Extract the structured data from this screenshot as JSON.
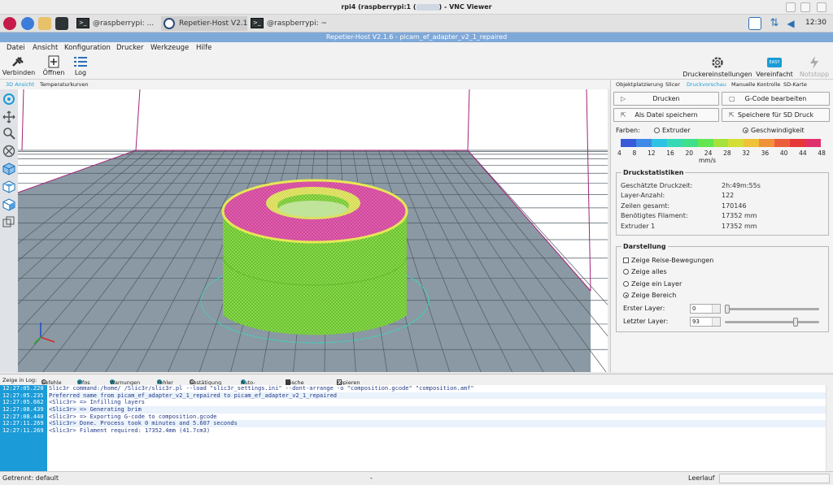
{
  "vnc": {
    "title_prefix": "rpi4 (raspberrypi:1 (",
    "title_suffix": ") - VNC Viewer"
  },
  "taskbar": {
    "tasks": [
      "@raspberrypi: ...",
      "Repetier-Host V2.1...",
      "@raspberrypi: ~"
    ],
    "time": "12:30"
  },
  "app": {
    "title": "Repetier-Host V2.1.6 - picam_ef_adapter_v2_1_repaired"
  },
  "menu": [
    "Datei",
    "Ansicht",
    "Konfiguration",
    "Drucker",
    "Werkzeuge",
    "Hilfe"
  ],
  "toolbar": {
    "connect": "Verbinden",
    "open": "Öffnen",
    "log": "Log",
    "printer_settings": "Druckereinstellungen",
    "easy_badge": "EASY",
    "simplified": "Vereinfacht",
    "emergency": "Notstopp"
  },
  "view_tabs": [
    "3D Ansicht",
    "Temperaturkurven"
  ],
  "right_tabs": [
    "Objektplatzierung",
    "Slicer",
    "Druckvorschau",
    "Manuelle Kontrolle",
    "SD-Karte"
  ],
  "preview": {
    "print": "Drucken",
    "edit_gcode": "G-Code bearbeiten",
    "save_file": "Als Datei speichern",
    "save_sd": "Speichere für SD Druck",
    "colors_label": "Farben:",
    "color_extruder": "Extruder",
    "color_speed": "Geschwindigkeit",
    "scale_colors": [
      "#3a5bd9",
      "#3f8ae6",
      "#2fc3e3",
      "#36d9b4",
      "#3fe08a",
      "#63e651",
      "#a5e23c",
      "#d4de35",
      "#efc23a",
      "#f0923a",
      "#ec5e3b",
      "#e63838",
      "#e0306a"
    ],
    "scale_ticks": [
      "4",
      "8",
      "12",
      "16",
      "20",
      "24",
      "28",
      "32",
      "36",
      "40",
      "44",
      "48"
    ],
    "scale_unit": "mm/s"
  },
  "stats": {
    "title": "Druckstatistiken",
    "rows": [
      {
        "k": "Geschätzte Druckzeit:",
        "v": "2h:49m:55s"
      },
      {
        "k": "Layer-Anzahl:",
        "v": "122"
      },
      {
        "k": "Zeilen gesamt:",
        "v": "170146"
      },
      {
        "k": "Benötigtes Filament:",
        "v": "17352 mm"
      },
      {
        "k": "Extruder 1",
        "v": "17352 mm"
      }
    ]
  },
  "display": {
    "title": "Darstellung",
    "travel": "Zeige Reise-Bewegungen",
    "all": "Zeige alles",
    "one_layer": "Zeige ein Layer",
    "range": "Zeige Bereich",
    "first_layer_label": "Erster Layer:",
    "first_layer_value": "0",
    "last_layer_label": "Letzter Layer:",
    "last_layer_value": "93",
    "first_layer_level": 0.0,
    "last_layer_level": 0.76
  },
  "logbar": {
    "label": "Zeige in Log:",
    "items": [
      "Befehle",
      "Infos",
      "Warnungen",
      "Fehler",
      "Bestätigung",
      "Auto-Scroll"
    ],
    "clear": "Lösche Log",
    "copy": "Kopieren"
  },
  "log": [
    {
      "t": "12:27:05.220",
      "m": "Slic3r command:/home/     /Slic3r/slic3r.pl --load \"slic3r_settings.ini\" --dont-arrange -o \"composition.gcode\" \"composition.amf\""
    },
    {
      "t": "12:27:05.235",
      "m": "Preferred name from picam_ef_adapter_v2_1_repaired to picam_ef_adapter_v2_1_repaired"
    },
    {
      "t": "12:27:05.662",
      "m": "<Slic3r> => Infilling layers"
    },
    {
      "t": "12:27:08.439",
      "m": "<Slic3r> => Generating brim"
    },
    {
      "t": "12:27:08.440",
      "m": "<Slic3r> => Exporting G-code to composition.gcode"
    },
    {
      "t": "12:27:11.269",
      "m": "<Slic3r> Done. Process took 0 minutes and 5.607 seconds"
    },
    {
      "t": "12:27:11.269",
      "m": "<Slic3r> Filament required: 17352.4mm (41.7cm3)"
    }
  ],
  "status": {
    "left": "Getrennt: default",
    "mid": "-",
    "right": "Leerlauf"
  }
}
